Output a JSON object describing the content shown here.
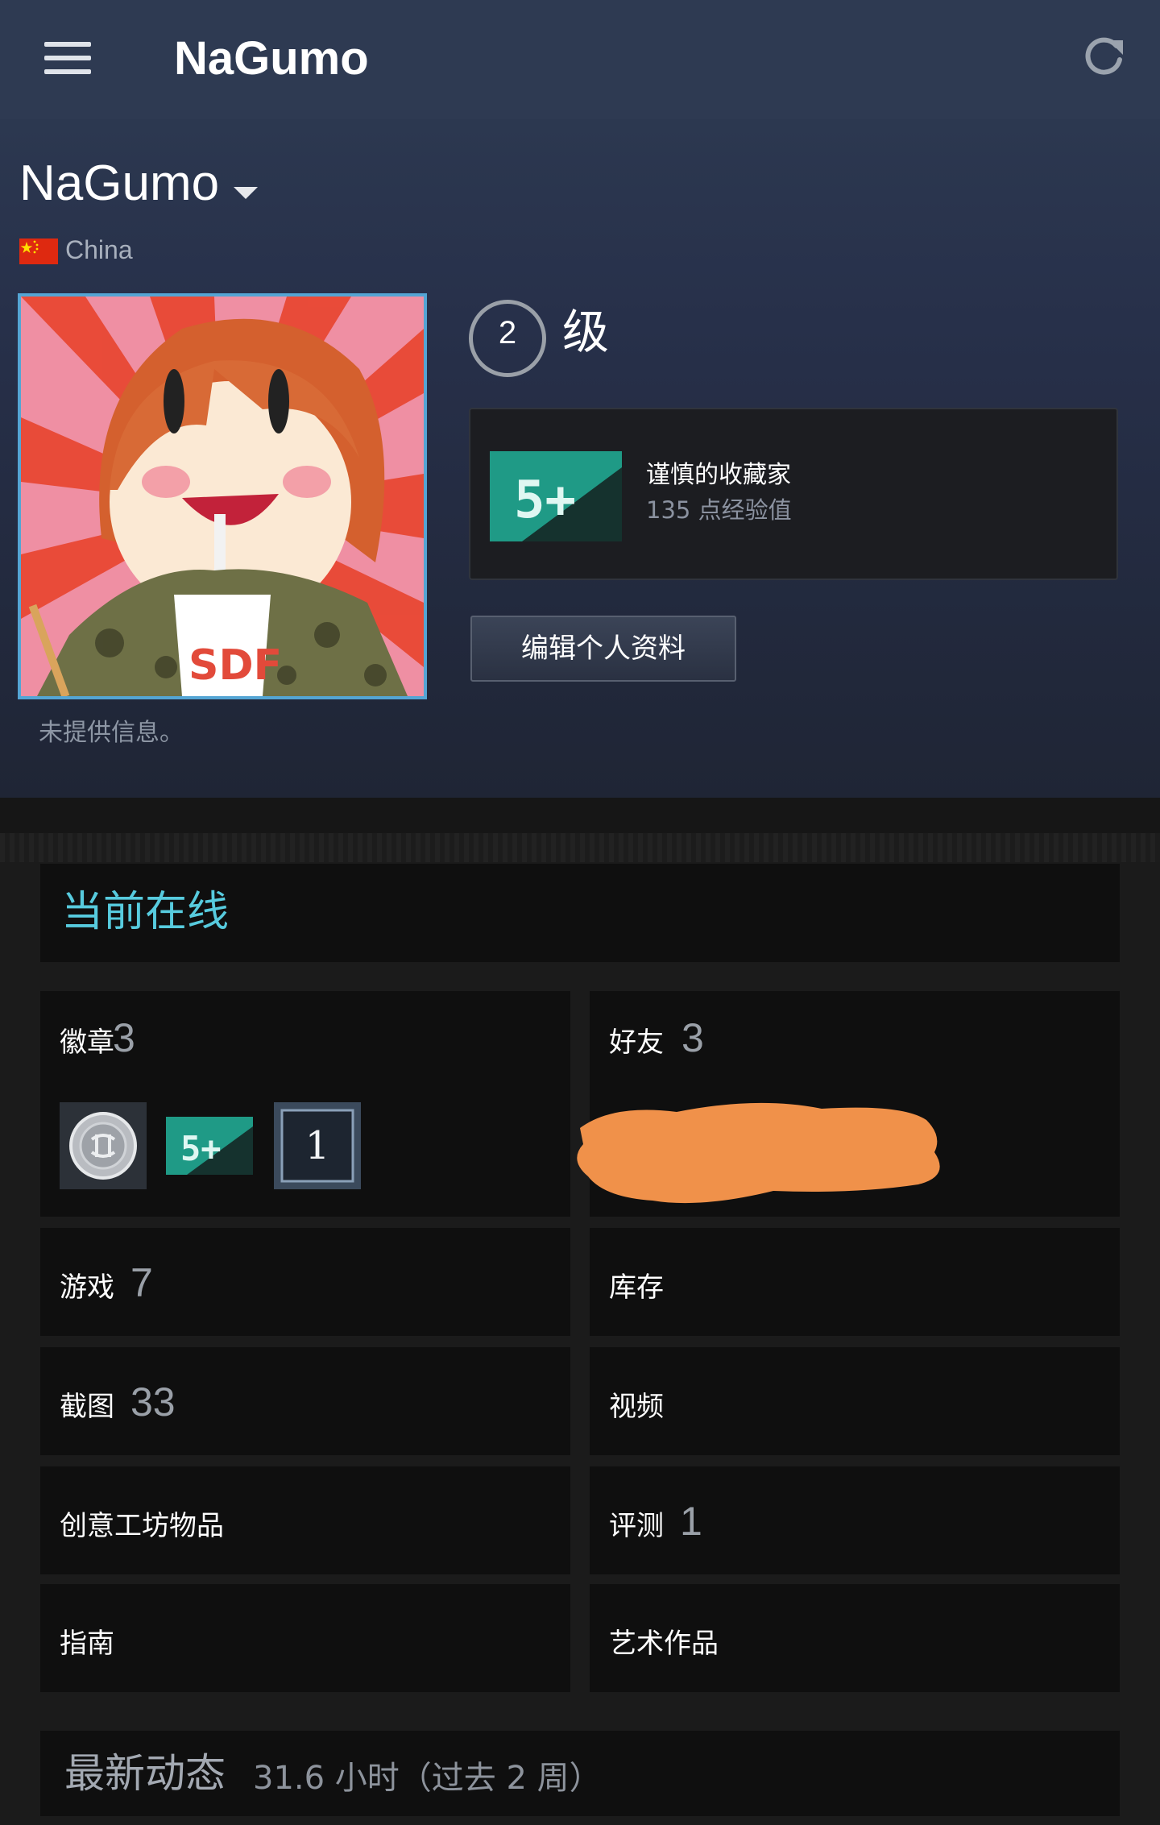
{
  "appbar": {
    "title": "NaGumo",
    "menu_icon": "hamburger-menu-icon",
    "refresh_icon": "refresh-icon"
  },
  "profile": {
    "persona_name": "NaGumo",
    "country": "China",
    "flag": "china-flag-icon",
    "summary": "未提供信息。",
    "level_number": "2",
    "level_label": "级",
    "featured_badge": {
      "icon_text": "5+",
      "name": "谨慎的收藏家",
      "xp": "135 点经验值"
    },
    "edit_button": "编辑个人资料"
  },
  "status": {
    "text": "当前在线",
    "color": "#57cbde"
  },
  "tiles": {
    "badges": {
      "label": "徽章",
      "count": "3"
    },
    "friends": {
      "label": "好友",
      "count": "3"
    },
    "games": {
      "label": "游戏",
      "count": "7"
    },
    "inventory": {
      "label": "库存"
    },
    "screenshots": {
      "label": "截图",
      "count": "33"
    },
    "videos": {
      "label": "视频"
    },
    "workshop": {
      "label": "创意工坊物品"
    },
    "reviews": {
      "label": "评测",
      "count": "1"
    },
    "guides": {
      "label": "指南"
    },
    "artwork": {
      "label": "艺术作品"
    }
  },
  "badge_icons": [
    {
      "name": "silver-coin-badge-icon"
    },
    {
      "name": "collector-badge-icon",
      "text": "5+"
    },
    {
      "name": "years-of-service-badge-icon",
      "text": "1"
    }
  ],
  "activity": {
    "title": "最新动态",
    "hours": "31.6 小时（过去 2 周）"
  },
  "colors": {
    "appbar": "#2e3a52",
    "tile_bg": "#0f0f0f",
    "accent": "#57cbde",
    "badge_teal": "#1f9a86",
    "redaction": "#f0914a"
  }
}
